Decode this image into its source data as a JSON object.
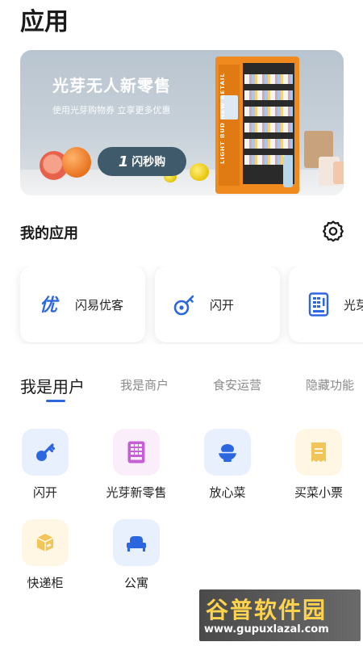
{
  "page": {
    "title": "应用"
  },
  "banner": {
    "title": "光芽无人新零售",
    "subtitle": "使用光芽购物券 立享更多优惠",
    "button_number": "1",
    "button_label": "闪秒购",
    "machine_text": "LIGHT BUD NEW RETAIL"
  },
  "my_apps": {
    "title": "我的应用",
    "settings_icon": "gear-icon",
    "items": [
      {
        "label": "闪易优客",
        "icon": "youke-icon",
        "color": "#2d67e0"
      },
      {
        "label": "闪开",
        "icon": "key-icon",
        "color": "#2d67e0"
      },
      {
        "label": "光芽",
        "icon": "vending-machine-icon",
        "color": "#2d67e0"
      }
    ]
  },
  "tabs": [
    {
      "label": "我是用户",
      "active": true
    },
    {
      "label": "我是商户",
      "active": false
    },
    {
      "label": "食安运营",
      "active": false
    },
    {
      "label": "隐藏功能",
      "active": false
    }
  ],
  "grid": [
    {
      "label": "闪开",
      "icon": "key-icon",
      "bg": "#e8f0fd",
      "fg": "#2d67e0"
    },
    {
      "label": "光芽新零售",
      "icon": "vending-machine-icon",
      "bg": "#fbeefb",
      "fg": "#c65fd4"
    },
    {
      "label": "放心菜",
      "icon": "vegetable-bowl-icon",
      "bg": "#e8f0fd",
      "fg": "#2d67e0"
    },
    {
      "label": "买菜小票",
      "icon": "receipt-icon",
      "bg": "#fff6e4",
      "fg": "#f2c55a"
    },
    {
      "label": "快递柜",
      "icon": "parcel-box-icon",
      "bg": "#fff6e4",
      "fg": "#f2c55a"
    },
    {
      "label": "公寓",
      "icon": "bed-icon",
      "bg": "#e8f0fd",
      "fg": "#2d67e0"
    }
  ],
  "watermark": {
    "title": "谷普软件园",
    "url": "www.gupuxlazal.com"
  },
  "colors": {
    "accent": "#2d67e0",
    "text": "#1a1a1a",
    "muted": "#8a8a8a"
  }
}
